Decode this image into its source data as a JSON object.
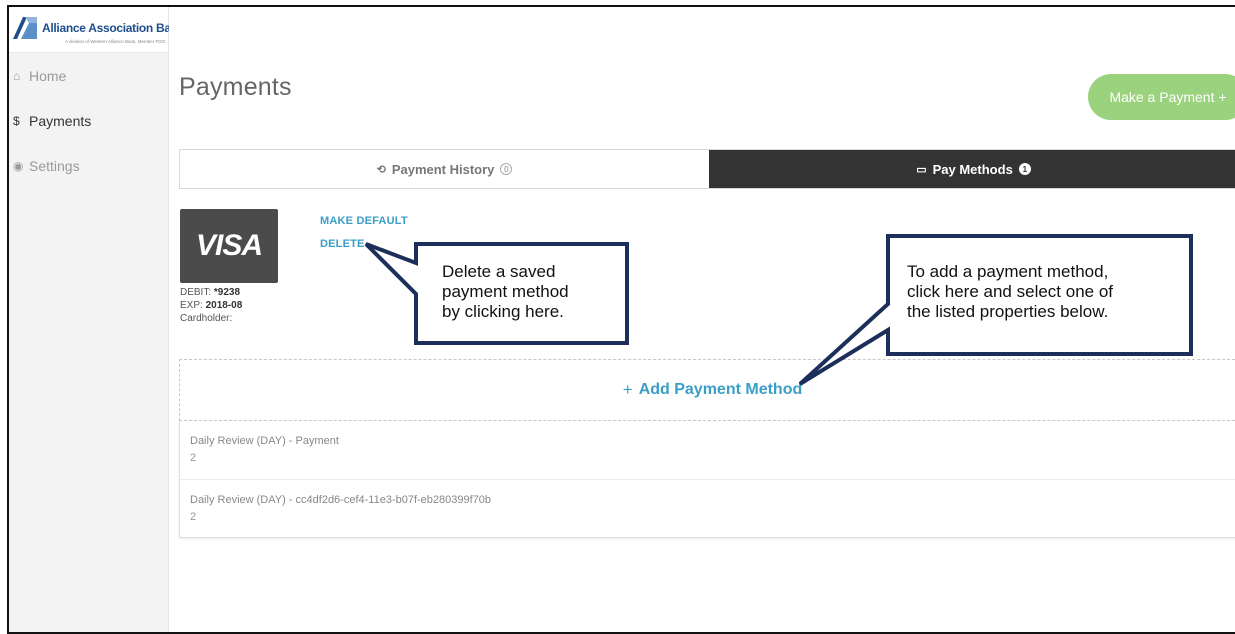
{
  "brand": {
    "name": "Alliance Association Bank",
    "tagline": "A division of Western Alliance Bank, Member FDIC"
  },
  "sidebar": {
    "items": [
      {
        "label": "Home",
        "icon": "home-icon",
        "glyph": "⌂"
      },
      {
        "label": "Payments",
        "icon": "dollar-icon",
        "glyph": "$"
      },
      {
        "label": "Settings",
        "icon": "user-circle-icon",
        "glyph": "◉"
      }
    ]
  },
  "page": {
    "title": "Payments",
    "make_payment_label": "Make a Payment +"
  },
  "tabs": {
    "history_label": "Payment History",
    "history_count": "0",
    "methods_label": "Pay Methods",
    "methods_count": "1"
  },
  "card": {
    "brand": "VISA",
    "debit_label": "DEBIT:",
    "debit_value": "*9238",
    "exp_label": "EXP:",
    "exp_value": "2018-08",
    "cardholder_label": "Cardholder:",
    "make_default_label": "MAKE DEFAULT",
    "delete_label": "DELETE"
  },
  "add_method_label": "Add Payment Method",
  "properties": [
    {
      "name": "Daily Review (DAY) - Payment",
      "sub": "2"
    },
    {
      "name": "Daily Review (DAY) - cc4df2d6-cef4-11e3-b07f-eb280399f70b",
      "sub": "2"
    }
  ],
  "callouts": {
    "delete": [
      "Delete a saved",
      "payment method",
      "by clicking here."
    ],
    "add": [
      "To add a payment method,",
      "click here and select one of",
      "the listed properties below."
    ]
  },
  "colors": {
    "accent": "#3a9fc7",
    "make_payment": "#9bd27d",
    "active_tab": "#333333",
    "callout_border": "#1c2f5a"
  }
}
